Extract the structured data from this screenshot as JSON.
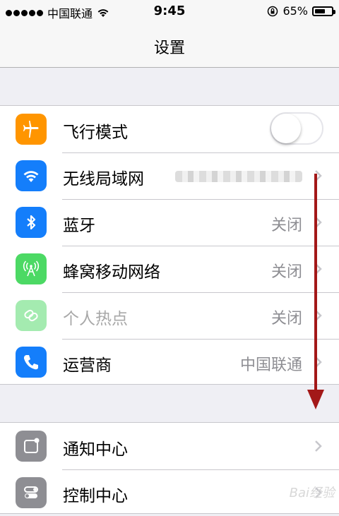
{
  "status_bar": {
    "carrier": "中国联通",
    "time": "9:45",
    "battery": "65%",
    "battery_level": 0.65
  },
  "nav": {
    "title": "设置"
  },
  "group1": [
    {
      "label": "飞行模式",
      "icon": "airplane-icon",
      "color": "#ff9500",
      "control": "toggle",
      "toggle_on": false
    },
    {
      "label": "无线局域网",
      "icon": "wifi-icon",
      "color": "#147efb",
      "value_obscured": true
    },
    {
      "label": "蓝牙",
      "icon": "bluetooth-icon",
      "color": "#147efb",
      "value": "关闭"
    },
    {
      "label": "蜂窝移动网络",
      "icon": "cellular-icon",
      "color": "#4cd964",
      "value": "关闭"
    },
    {
      "label": "个人热点",
      "icon": "hotspot-icon",
      "color": "#4cd964",
      "value": "关闭",
      "dimmed": true
    },
    {
      "label": "运营商",
      "icon": "phone-icon",
      "color": "#147efb",
      "value": "中国联通"
    }
  ],
  "group2": [
    {
      "label": "通知中心",
      "icon": "notification-center-icon",
      "color": "#8e8e93"
    },
    {
      "label": "控制中心",
      "icon": "control-center-icon",
      "color": "#8e8e93"
    }
  ],
  "annotation": {
    "arrow_color": "#a31818"
  },
  "watermark": {
    "text": "Bai经验"
  }
}
